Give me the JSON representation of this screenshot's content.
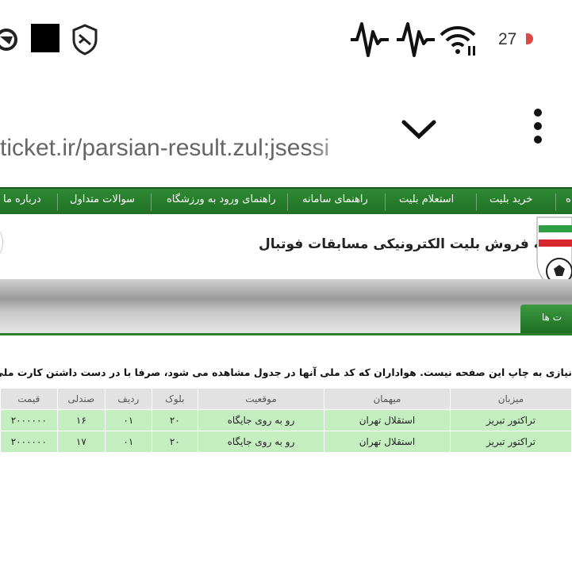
{
  "status_bar": {
    "battery": "27",
    "icons": [
      "incognito-icon",
      "square-icon",
      "shield-icon",
      "signal-icon",
      "signal-icon",
      "wifi-icon"
    ]
  },
  "browser": {
    "url": "ticket.ir/parsian-result.zul;jsessi"
  },
  "nav": {
    "items": [
      "ه",
      "خرید بلیت",
      "استعلام بلیت",
      "راهنمای سامانه",
      "راهنمای ورود به ورزشگاه",
      "سوالات متداول",
      "درباره ما"
    ]
  },
  "header": {
    "title": "سامانه فروش بلیت الکترونیکی مسابقات فوتبال",
    "tab_label": "ت ها"
  },
  "notice": {
    "text": "نیازی به چاپ این صفحه نیست. هواداران که کد ملی آنها در جدول مشاهده می شود، صرفا با در دست داشتن کارت ملی و یا شناسنامه"
  },
  "table": {
    "headers": {
      "host": "میزبان",
      "guest": "میهمان",
      "position": "موقعیت",
      "block": "بلوک",
      "row": "ردیف",
      "seat": "صندلی",
      "price": "قیمت"
    },
    "rows": [
      {
        "host": "تراکتور تبریز",
        "guest": "استقلال تهران",
        "position": "رو به روی جایگاه",
        "block": "۲۰",
        "row": "۰۱",
        "seat": "۱۶",
        "price": "۲۰۰۰۰۰۰"
      },
      {
        "host": "تراکتور تبریز",
        "guest": "استقلال تهران",
        "position": "رو به روی جایگاه",
        "block": "۲۰",
        "row": "۰۱",
        "seat": "۱۷",
        "price": "۲۰۰۰۰۰۰"
      }
    ]
  },
  "colors": {
    "nav_green": "#2f8a33",
    "row_green": "#c5eec0",
    "header_gray": "#e2e2e2"
  }
}
